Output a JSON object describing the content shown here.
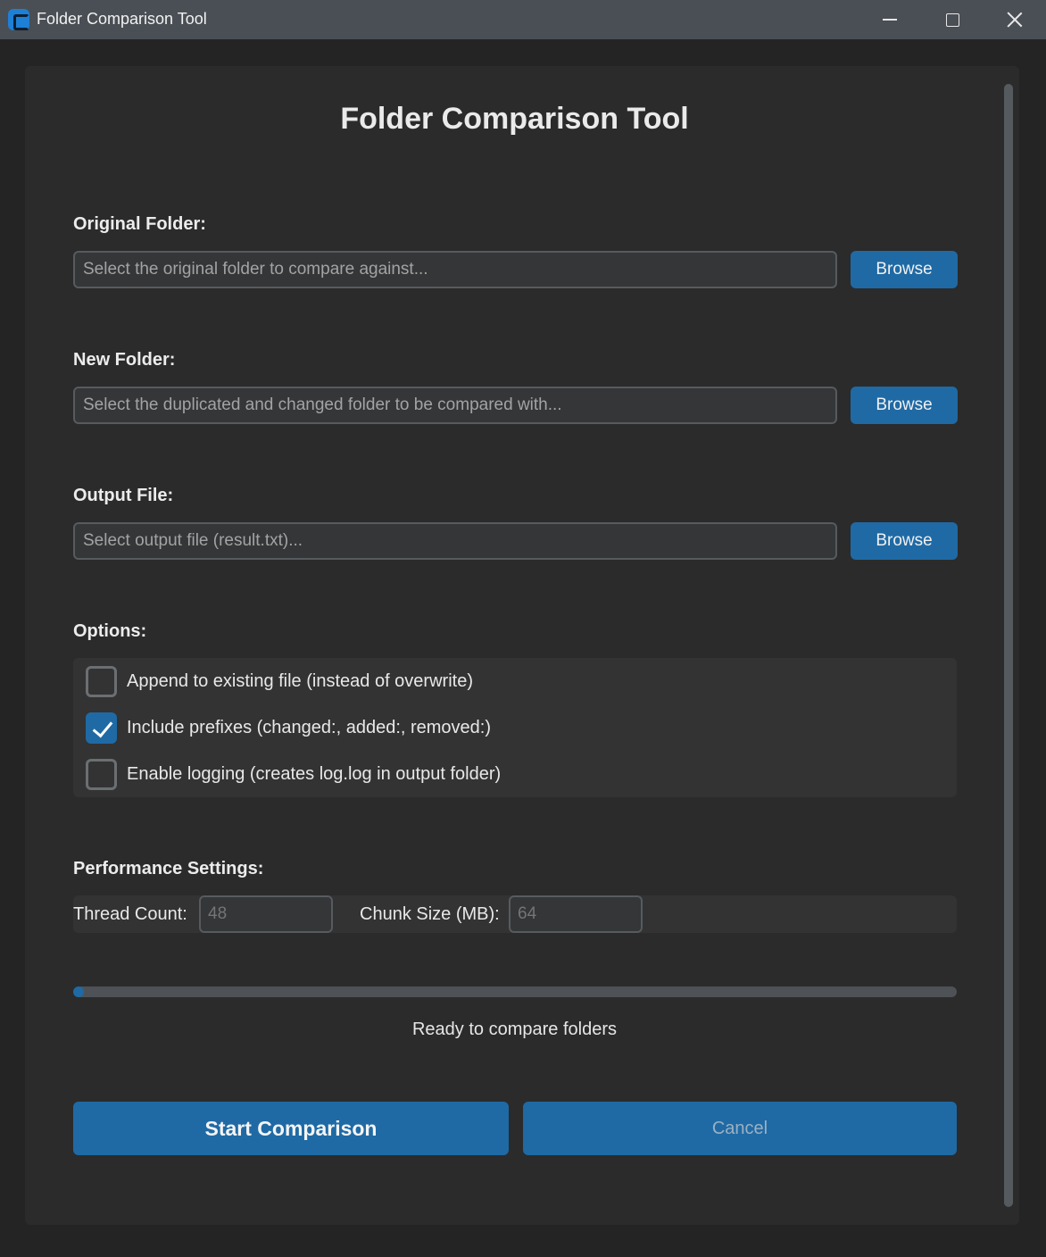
{
  "window": {
    "title": "Folder Comparison Tool",
    "icon": "app-icon"
  },
  "main": {
    "title": "Folder Comparison Tool"
  },
  "original_folder": {
    "label": "Original Folder:",
    "value": "",
    "placeholder": "Select the original folder to compare against...",
    "browse_label": "Browse"
  },
  "new_folder": {
    "label": "New Folder:",
    "value": "",
    "placeholder": "Select the duplicated and changed folder to be compared with...",
    "browse_label": "Browse"
  },
  "output_file": {
    "label": "Output File:",
    "value": "",
    "placeholder": "Select output file (result.txt)...",
    "browse_label": "Browse"
  },
  "options": {
    "label": "Options:",
    "items": [
      {
        "label": "Append to existing file (instead of overwrite)",
        "checked": false
      },
      {
        "label": "Include prefixes (changed:, added:, removed:)",
        "checked": true
      },
      {
        "label": "Enable logging (creates log.log in output folder)",
        "checked": false
      }
    ]
  },
  "performance": {
    "label": "Performance Settings:",
    "thread_count_label": "Thread Count:",
    "thread_count_placeholder": "48",
    "chunk_size_label": "Chunk Size (MB):",
    "chunk_size_placeholder": "64"
  },
  "progress": {
    "fraction": 0.01,
    "status": "Ready to compare folders"
  },
  "actions": {
    "start_label": "Start Comparison",
    "cancel_label": "Cancel"
  },
  "colors": {
    "accent": "#1f6aa5",
    "background": "#2b2b2b",
    "titlebar": "#4a4f55"
  }
}
